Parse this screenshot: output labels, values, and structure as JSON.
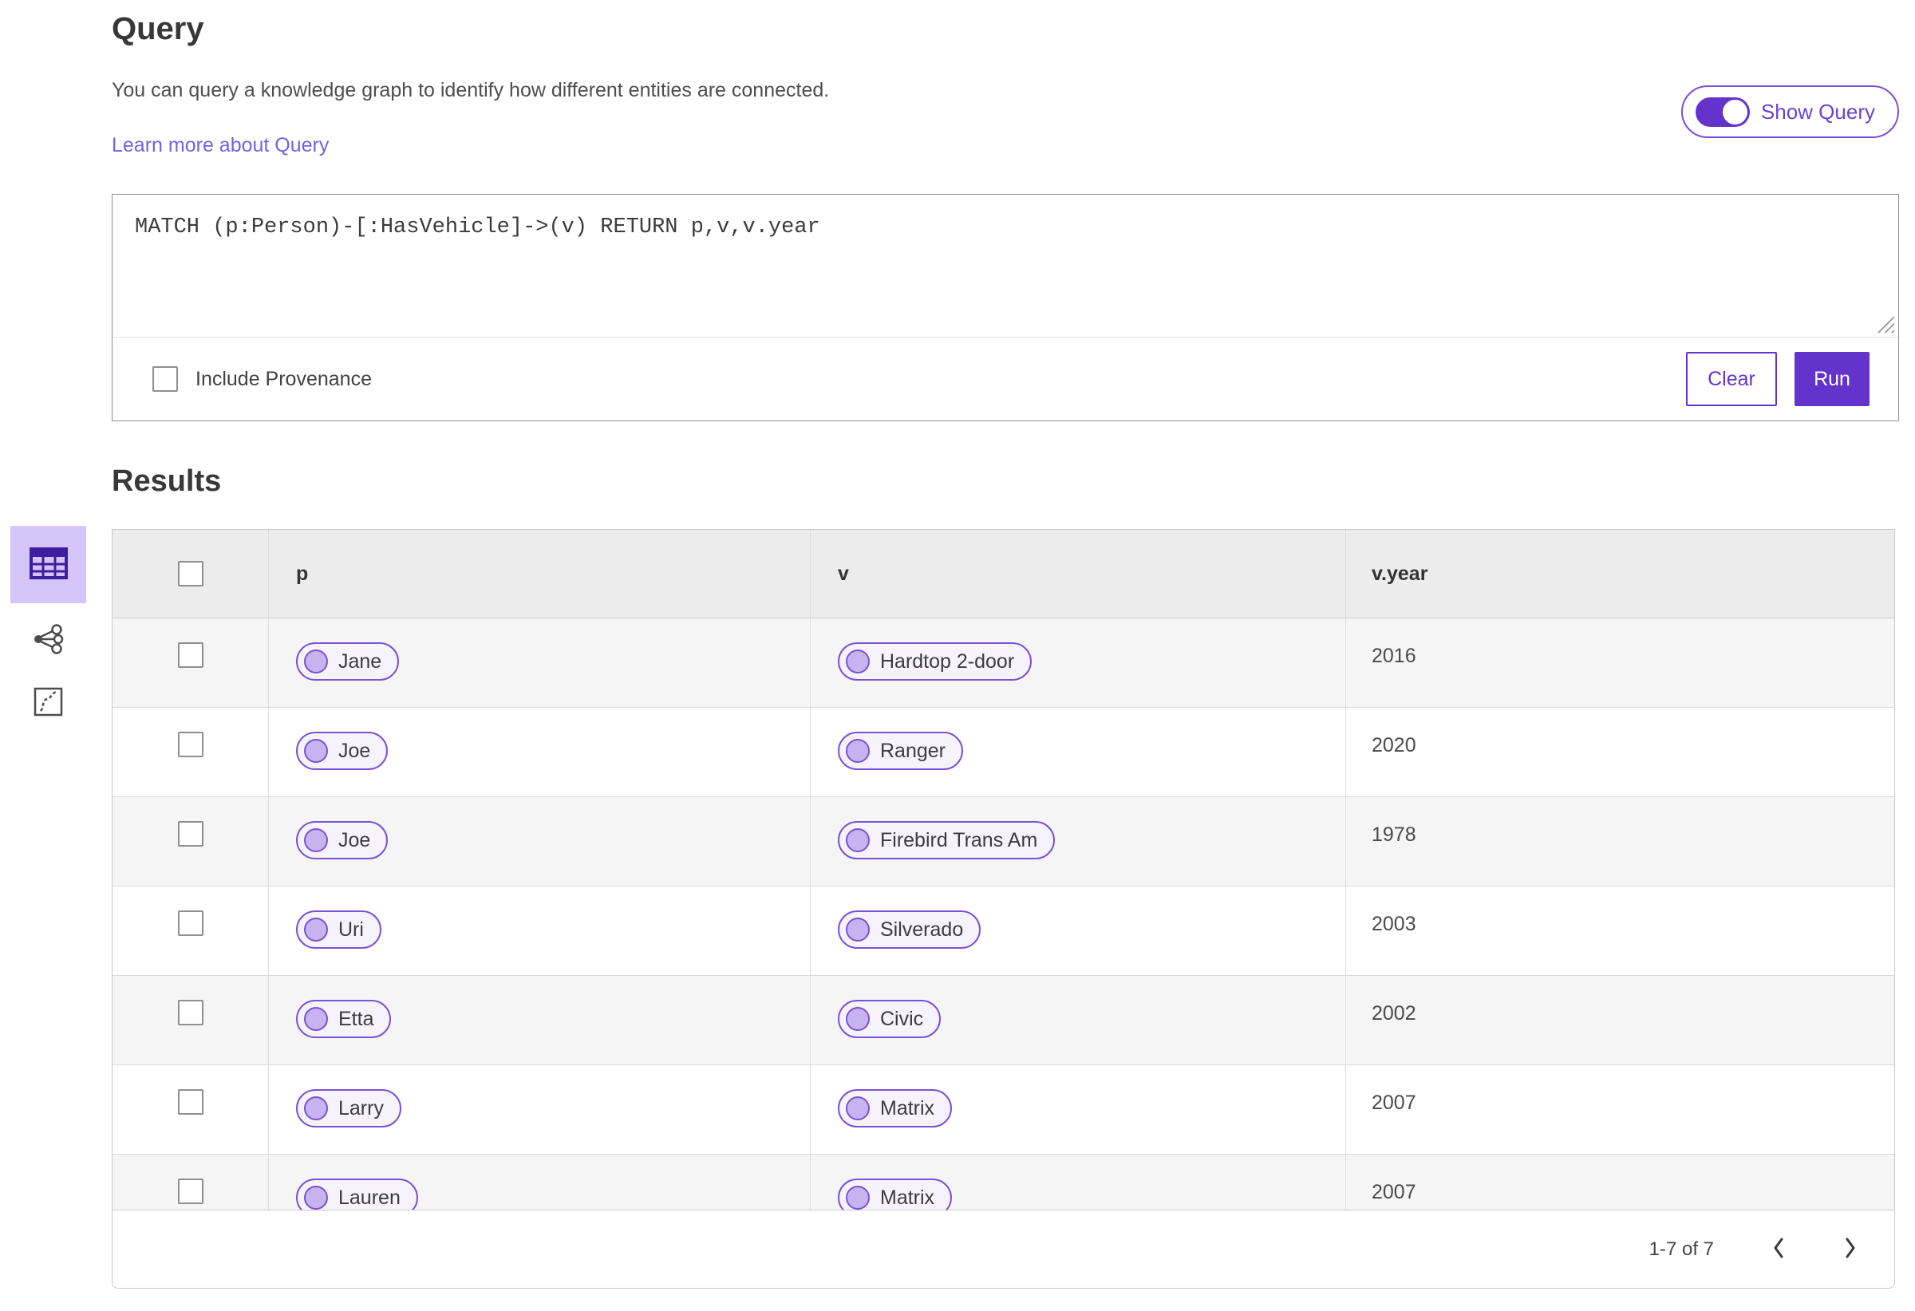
{
  "header": {
    "title": "Query",
    "description": "You can query a knowledge graph to identify how different entities are connected.",
    "learn_more_label": "Learn more about Query",
    "show_query_label": "Show Query",
    "show_query_on": true
  },
  "query_editor": {
    "query_text": "MATCH (p:Person)-[:HasVehicle]->(v) RETURN p,v,v.year",
    "include_provenance_label": "Include Provenance",
    "include_provenance_checked": false,
    "clear_label": "Clear",
    "run_label": "Run"
  },
  "results": {
    "title": "Results",
    "views": [
      {
        "name": "table-view",
        "selected": true
      },
      {
        "name": "network-view",
        "selected": false
      },
      {
        "name": "map-view",
        "selected": false
      }
    ],
    "table": {
      "columns": [
        "p",
        "v",
        "v.year"
      ],
      "rows": [
        {
          "p": "Jane",
          "v": "Hardtop 2-door",
          "year": "2016"
        },
        {
          "p": "Joe",
          "v": "Ranger",
          "year": "2020"
        },
        {
          "p": "Joe",
          "v": "Firebird Trans Am",
          "year": "1978"
        },
        {
          "p": "Uri",
          "v": "Silverado",
          "year": "2003"
        },
        {
          "p": "Etta",
          "v": "Civic",
          "year": "2002"
        },
        {
          "p": "Larry",
          "v": "Matrix",
          "year": "2007"
        },
        {
          "p": "Lauren",
          "v": "Matrix",
          "year": "2007"
        }
      ]
    },
    "pagination": {
      "range_label": "1-7 of 7"
    }
  },
  "colors": {
    "accent": "#6333cb",
    "toggle_border": "#7a4fd8",
    "link": "#7262e2",
    "pill_border": "#7a52d4",
    "pill_background": "#f6f3fd",
    "pill_dot": "#c8b3f1",
    "selected_view_background": "#d5c4f8",
    "alt_row_background": "#f5f5f5",
    "table_header_background": "#ececec"
  }
}
